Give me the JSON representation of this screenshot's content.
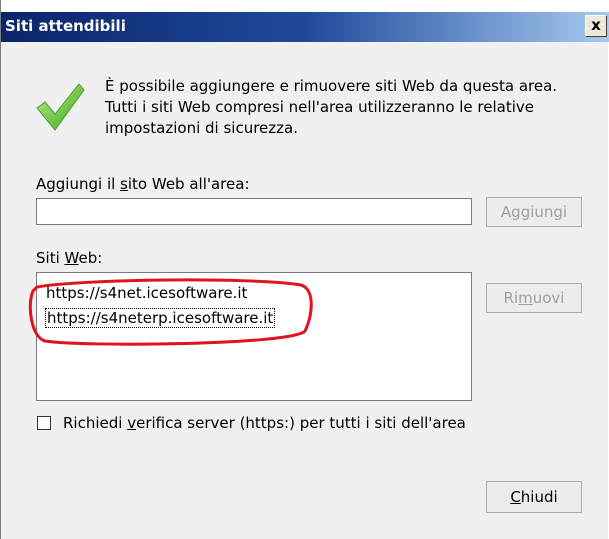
{
  "window": {
    "title": "Siti attendibili",
    "close_label": "x",
    "accent_color": "#0a246a"
  },
  "info": {
    "icon": "checkmark-icon",
    "line1": "È possibile aggiungere e rimuovere siti Web da questa area.",
    "line2": "Tutti i siti Web compresi nell'area utilizzeranno le relative",
    "line3": "impostazioni di sicurezza."
  },
  "add_site": {
    "label_pre": "Aggiungi il ",
    "label_ul": "s",
    "label_post": "ito Web all'area:",
    "input_value": "",
    "button_pre": "A",
    "button_ul": "g",
    "button_post": "giungi"
  },
  "sites": {
    "label_pre": "Siti ",
    "label_ul": "W",
    "label_post": "eb:",
    "items": [
      "https://s4net.icesoftware.it",
      "https://s4neterp.icesoftware.it"
    ],
    "remove_pre": "Ri",
    "remove_ul": "m",
    "remove_post": "uovi",
    "highlight_color": "#e0141e"
  },
  "verify": {
    "checked": false,
    "label_pre": "Richiedi ",
    "label_ul": "v",
    "label_post": "erifica server (https:) per tutti i siti dell'area"
  },
  "footer": {
    "close_ul": "C",
    "close_post": "hiudi"
  }
}
